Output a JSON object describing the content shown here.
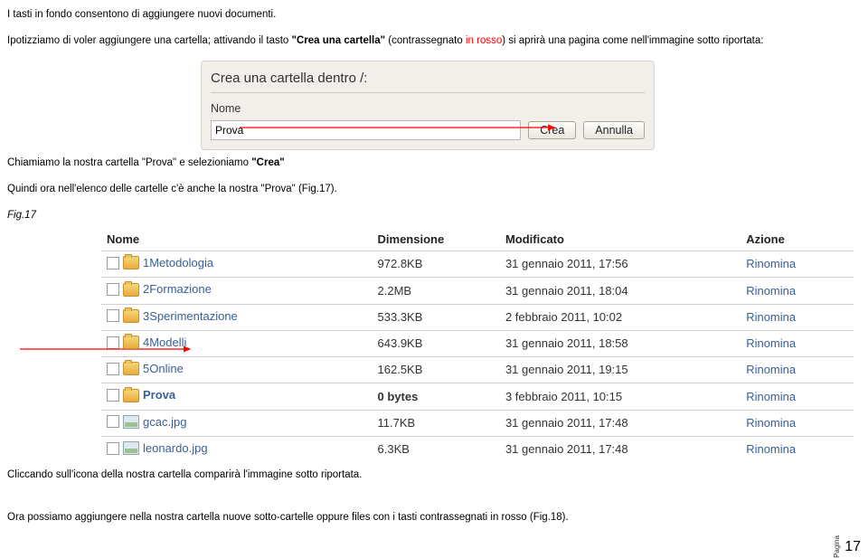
{
  "p1_a": "I tasti in fondo consentono di aggiungere nuovi documenti.",
  "p2_a": "Ipotizziamo di voler aggiungere una cartella; attivando il tasto ",
  "p2_b": "\"Crea una cartella\"",
  "p2_c": " (contrassegnato ",
  "p2_d": "in rosso",
  "p2_e": ") si aprirà una pagina come nell'immagine sotto riportata:",
  "fig16": {
    "title": "Crea una cartella dentro /:",
    "sublabel": "Nome",
    "value": "Prova",
    "btn_crea": "Crea",
    "btn_annulla": "Annulla"
  },
  "p3_a": "Chiamiamo la nostra cartella \"Prova\" e selezioniamo ",
  "p3_b": "\"Crea\"",
  "p4": "Quindi ora nell'elenco delle cartelle c'è anche la nostra \"Prova\" (Fig.17).",
  "figlabel17": "Fig.17",
  "fig17": {
    "headers": {
      "nome": "Nome",
      "dimensione": "Dimensione",
      "modificato": "Modificato",
      "azione": "Azione"
    },
    "rows": [
      {
        "type": "fld",
        "name": "1Metodologia",
        "size": "972.8KB",
        "mod": "31 gennaio 2011, 17:56",
        "act": "Rinomina"
      },
      {
        "type": "fld",
        "name": "2Formazione",
        "size": "2.2MB",
        "mod": "31 gennaio 2011, 18:04",
        "act": "Rinomina"
      },
      {
        "type": "fld",
        "name": "3Sperimentazione",
        "size": "533.3KB",
        "mod": "2 febbraio 2011, 10:02",
        "act": "Rinomina"
      },
      {
        "type": "fld",
        "name": "4Modelli",
        "size": "643.9KB",
        "mod": "31 gennaio 2011, 18:58",
        "act": "Rinomina"
      },
      {
        "type": "fld",
        "name": "5Online",
        "size": "162.5KB",
        "mod": "31 gennaio 2011, 19:15",
        "act": "Rinomina"
      },
      {
        "type": "fld",
        "name": "Prova",
        "size": "0 bytes",
        "mod": "3 febbraio 2011, 10:15",
        "act": "Rinomina",
        "bold": true
      },
      {
        "type": "img",
        "name": "gcac.jpg",
        "size": "11.7KB",
        "mod": "31 gennaio 2011, 17:48",
        "act": "Rinomina"
      },
      {
        "type": "img",
        "name": "leonardo.jpg",
        "size": "6.3KB",
        "mod": "31 gennaio 2011, 17:48",
        "act": "Rinomina"
      }
    ]
  },
  "p5": "Cliccando sull'icona della nostra cartella comparirà l'immagine sotto riportata.",
  "p6": "Ora possiamo aggiungere nella nostra cartella nuove sotto-cartelle oppure files con i tasti contrassegnati in rosso (Fig.18).",
  "page_label": "Pagina",
  "page_num": "17"
}
